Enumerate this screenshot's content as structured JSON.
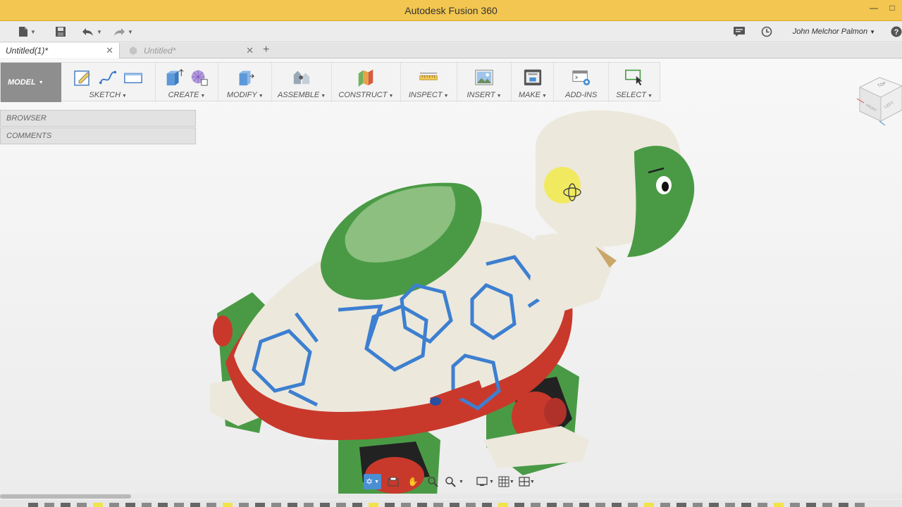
{
  "window": {
    "title": "Autodesk Fusion 360",
    "controls": [
      "minimize-icon",
      "maximize-icon"
    ]
  },
  "quick_access": {
    "user_name": "John Melchor Palmon",
    "icons": [
      "file-icon",
      "save-icon",
      "undo-icon",
      "redo-icon",
      "job-status-icon",
      "history-icon",
      "help-icon"
    ]
  },
  "tabs": [
    {
      "label": "Untitled(1)*",
      "active": true
    },
    {
      "label": "Untitled*",
      "active": false
    }
  ],
  "toolbar": {
    "workspace": "MODEL",
    "groups": [
      {
        "label": "SKETCH",
        "icons": [
          "sketch-icon",
          "spline-icon",
          "rectangle-icon"
        ]
      },
      {
        "label": "CREATE",
        "icons": [
          "extrude-icon",
          "form-icon"
        ]
      },
      {
        "label": "MODIFY",
        "icons": [
          "press-pull-icon"
        ]
      },
      {
        "label": "ASSEMBLE",
        "icons": [
          "joint-icon"
        ]
      },
      {
        "label": "CONSTRUCT",
        "icons": [
          "plane-icon"
        ]
      },
      {
        "label": "INSPECT",
        "icons": [
          "measure-icon"
        ]
      },
      {
        "label": "INSERT",
        "icons": [
          "insert-image-icon"
        ]
      },
      {
        "label": "MAKE",
        "icons": [
          "print-3d-icon"
        ]
      },
      {
        "label": "ADD-INS",
        "icons": [
          "scripts-icon"
        ]
      },
      {
        "label": "SELECT",
        "icons": [
          "select-icon"
        ]
      }
    ]
  },
  "panels": {
    "browser": "BROWSER",
    "comments": "COMMENTS"
  },
  "viewcube": {
    "faces": [
      "TOP",
      "FRONT",
      "LEFT"
    ]
  },
  "navbar": {
    "icons": [
      "orbit-icon",
      "look-at-icon",
      "pan-icon",
      "zoom-icon",
      "fit-icon",
      "display-settings-icon",
      "grid-icon",
      "viewports-icon"
    ]
  },
  "colors": {
    "titlebar": "#f2c650",
    "shell_white": "#ece8dc",
    "shell_green": "#4a9a45",
    "accent_red": "#c8392b",
    "pattern_blue": "#3d7fd0"
  }
}
